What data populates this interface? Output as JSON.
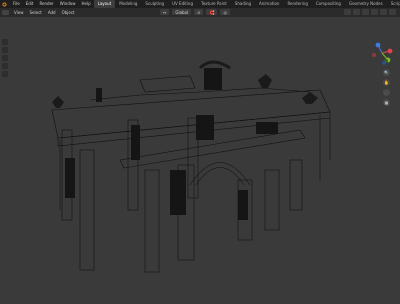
{
  "topbar": {
    "menus": [
      "File",
      "Edit",
      "Render",
      "Window",
      "Help"
    ],
    "tabs": [
      "Layout",
      "Modeling",
      "Sculpting",
      "UV Editing",
      "Texture Paint",
      "Shading",
      "Animation",
      "Rendering",
      "Compositing",
      "Geometry Nodes",
      "Scripting"
    ],
    "active_tab": "Layout"
  },
  "header": {
    "menus": [
      "View",
      "Select",
      "Add",
      "Object"
    ],
    "transform_orientation": "Global"
  },
  "colors": {
    "viewport_bg": "#3a3a3a",
    "wire": "#111111",
    "axis_x": "#e0434e",
    "axis_y": "#7bbd2b",
    "axis_z": "#3d7be0"
  },
  "nav": {
    "buttons": [
      "zoom-icon",
      "pan-icon",
      "camera-icon",
      "grid-icon"
    ]
  }
}
